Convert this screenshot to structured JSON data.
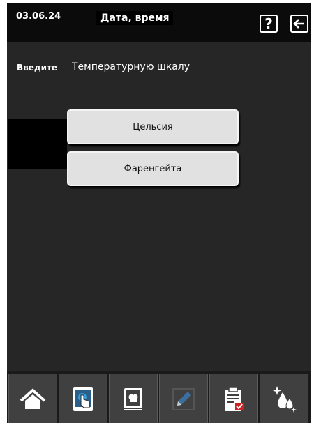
{
  "header": {
    "date": "03.06.24",
    "title": "Дата, время",
    "help_icon": "question-icon",
    "back_icon": "arrow-left-icon"
  },
  "prompt": {
    "label": "Введите",
    "text": "Температурную шкалу"
  },
  "options": [
    {
      "label": "Цельсия"
    },
    {
      "label": "Фаренгейта"
    }
  ],
  "bottom_nav": [
    {
      "icon": "home-icon"
    },
    {
      "icon": "tablet-touch-icon"
    },
    {
      "icon": "recipe-book-icon"
    },
    {
      "icon": "pencil-icon"
    },
    {
      "icon": "clipboard-icon"
    },
    {
      "icon": "cleaning-drops-icon"
    }
  ],
  "colors": {
    "background": "#262626",
    "header": "#0b0b0b",
    "button": "#e1e1e1",
    "nav_button": "#404040",
    "accent_blue": "#3a9bd9"
  }
}
